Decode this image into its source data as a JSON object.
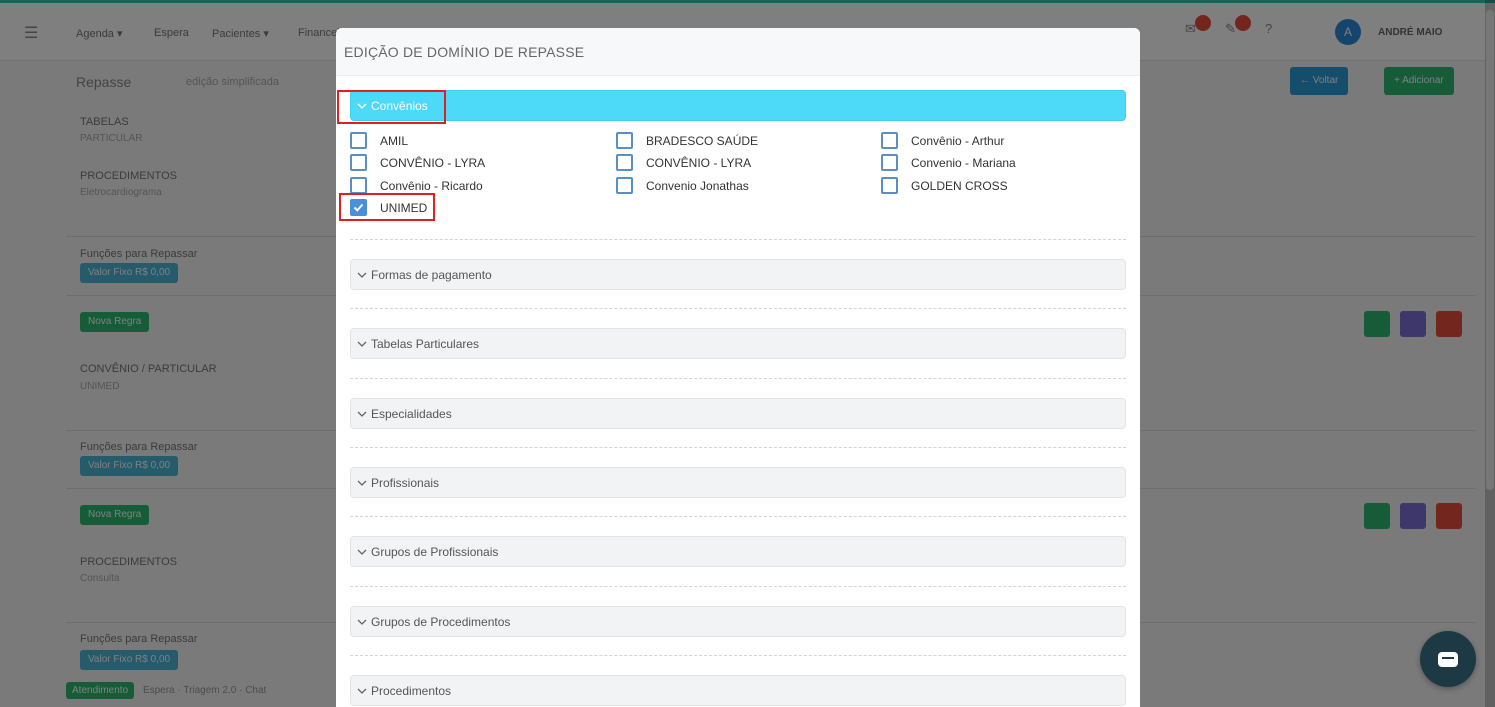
{
  "background_page": {
    "nav": {
      "items": [
        "Agenda ▾",
        "Espera",
        "Pacientes ▾",
        "Financeiro"
      ],
      "user": "ANDRÉ MAIO",
      "avatar_initial": "A"
    },
    "title": "Repasse",
    "subtitle": "edição simplificada",
    "buttons": [
      "← Voltar",
      "+ Adicionar"
    ],
    "rows": [
      {
        "label": "TABELAS",
        "value": "PARTICULAR"
      },
      {
        "label": "PROCEDIMENTOS",
        "value": "Eletrocardiograma"
      },
      {
        "label": "Funções para Repassar",
        "tag": "Valor Fixo R$ 0,00"
      },
      {
        "tag": "Nova Regra"
      },
      {
        "label": "CONVÊNIO / PARTICULAR",
        "value": "UNIMED"
      },
      {
        "label": "Funções para Repassar",
        "tag": "Valor Fixo R$ 0,00"
      },
      {
        "tag": "Nova Regra"
      },
      {
        "label": "PROCEDIMENTOS",
        "value": "Consulta"
      },
      {
        "label": "Funções para Repassar",
        "tag": "Valor Fixo R$ 0,00"
      }
    ],
    "footer": {
      "tag": "Atendimento",
      "text": "Espera · Triagem 2.0 · Chat"
    }
  },
  "modal": {
    "title": "EDIÇÃO DE DOMÍNIO DE REPASSE",
    "sections": [
      {
        "label": "Convênios",
        "expanded": true
      },
      {
        "label": "Formas de pagamento",
        "expanded": false
      },
      {
        "label": "Tabelas Particulares",
        "expanded": false
      },
      {
        "label": "Especialidades",
        "expanded": false
      },
      {
        "label": "Profissionais",
        "expanded": false
      },
      {
        "label": "Grupos de Profissionais",
        "expanded": false
      },
      {
        "label": "Grupos de Procedimentos",
        "expanded": false
      },
      {
        "label": "Procedimentos",
        "expanded": false
      }
    ],
    "convenios": [
      {
        "label": "AMIL",
        "checked": false
      },
      {
        "label": "BRADESCO SAÚDE",
        "checked": false
      },
      {
        "label": "Convênio - Arthur",
        "checked": false
      },
      {
        "label": "CONVÊNIO - LYRA",
        "checked": false
      },
      {
        "label": "CONVÊNIO - LYRA",
        "checked": false
      },
      {
        "label": "Convenio - Mariana",
        "checked": false
      },
      {
        "label": "Convênio - Ricardo",
        "checked": false
      },
      {
        "label": "Convenio Jonathas",
        "checked": false
      },
      {
        "label": "GOLDEN CROSS",
        "checked": false
      },
      {
        "label": "UNIMED",
        "checked": true
      }
    ]
  },
  "colors": {
    "accent_open_section": "#4dd9f8",
    "checkbox_border": "#5a8ec5",
    "checkbox_checked": "#4a90d9",
    "highlight_annotation": "#e02020",
    "green": "#2eb872"
  },
  "icons": {
    "chat": "chat-bubble-icon",
    "section_toggle": "chevron-down-icon",
    "checkmark": "checkmark-icon"
  }
}
